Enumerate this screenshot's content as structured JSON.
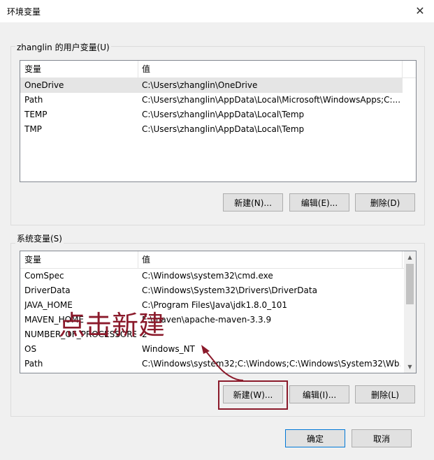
{
  "window": {
    "title": "环境变量",
    "close_glyph": "✕"
  },
  "user_group": {
    "label": "zhanglin 的用户变量(U)",
    "columns": [
      "变量",
      "值"
    ],
    "rows": [
      {
        "name": "OneDrive",
        "value": "C:\\Users\\zhanglin\\OneDrive"
      },
      {
        "name": "Path",
        "value": "C:\\Users\\zhanglin\\AppData\\Local\\Microsoft\\WindowsApps;C:..."
      },
      {
        "name": "TEMP",
        "value": "C:\\Users\\zhanglin\\AppData\\Local\\Temp"
      },
      {
        "name": "TMP",
        "value": "C:\\Users\\zhanglin\\AppData\\Local\\Temp"
      }
    ],
    "buttons": {
      "new": "新建(N)...",
      "edit": "编辑(E)...",
      "delete": "删除(D)"
    }
  },
  "system_group": {
    "label": "系统变量(S)",
    "columns": [
      "变量",
      "值"
    ],
    "rows": [
      {
        "name": "ComSpec",
        "value": "C:\\Windows\\system32\\cmd.exe"
      },
      {
        "name": "DriverData",
        "value": "C:\\Windows\\System32\\Drivers\\DriverData"
      },
      {
        "name": "JAVA_HOME",
        "value": "C:\\Program Files\\Java\\jdk1.8.0_101"
      },
      {
        "name": "MAVEN_HOME",
        "value": "E:\\maven\\apache-maven-3.3.9"
      },
      {
        "name": "NUMBER_OF_PROCESSORS",
        "value": "2"
      },
      {
        "name": "OS",
        "value": "Windows_NT"
      },
      {
        "name": "Path",
        "value": "C:\\Windows\\system32;C:\\Windows;C:\\Windows\\System32\\Wb..."
      }
    ],
    "buttons": {
      "new": "新建(W)...",
      "edit": "编辑(I)...",
      "delete": "删除(L)"
    }
  },
  "footer": {
    "ok": "确定",
    "cancel": "取消"
  },
  "annotation": {
    "text": "点击新建",
    "color": "#8b1a2b"
  }
}
